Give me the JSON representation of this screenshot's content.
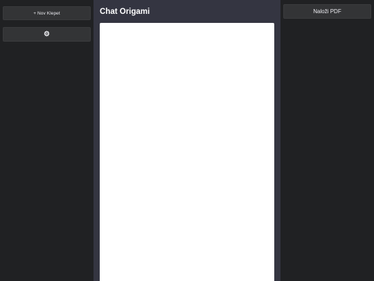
{
  "left_sidebar": {
    "new_chat_label": "+ Nov Klepet",
    "settings_icon": "gear-icon",
    "settings_glyph": "⚙"
  },
  "main": {
    "title": "Chat Origami"
  },
  "right_sidebar": {
    "upload_label": "Naloži PDF"
  },
  "colors": {
    "sidebar_bg": "#202123",
    "main_bg": "#343541",
    "button_bg": "#333436",
    "chat_bg": "#ffffff",
    "text": "#ececf1"
  }
}
